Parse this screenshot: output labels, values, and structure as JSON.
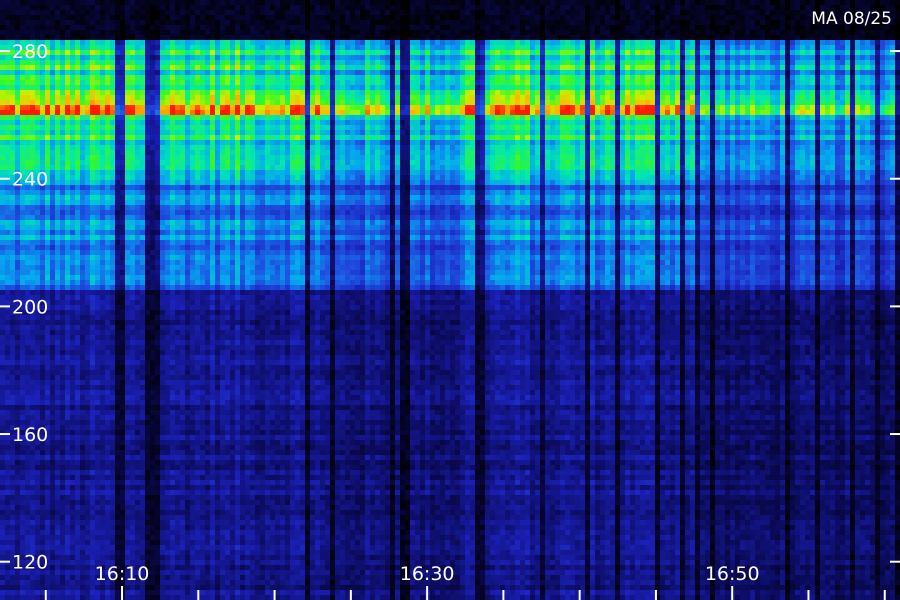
{
  "chart_data": {
    "type": "heatmap",
    "corner_label": "MA 08/25",
    "y_ticks": [
      280,
      240,
      200,
      160,
      120
    ],
    "ylim": [
      108,
      296
    ],
    "x_ticks": [
      "16:10",
      "16:30",
      "16:50"
    ],
    "xlim": [
      "16:02",
      "17:01"
    ],
    "grid": false,
    "colormap": [
      "#000000",
      "#0b0a58",
      "#1b20b8",
      "#1e4fe0",
      "#05a6f0",
      "#00e8b0",
      "#34f82a",
      "#c8f000",
      "#ffb000",
      "#ff1a00"
    ],
    "bands": [
      {
        "y": [
          260,
          268
        ],
        "intensity": 0.9
      },
      {
        "y": [
          240,
          284
        ],
        "intensity": 0.62
      },
      {
        "y": [
          205,
          240
        ],
        "intensity": 0.42
      },
      {
        "y": [
          108,
          205
        ],
        "intensity": 0.18
      }
    ],
    "bright_periods": [
      {
        "x": [
          "16:02",
          "16:23"
        ],
        "level": 1.0
      },
      {
        "x": [
          "16:23",
          "16:32"
        ],
        "level": 0.7
      },
      {
        "x": [
          "16:32",
          "16:48"
        ],
        "level": 1.0
      },
      {
        "x": [
          "16:48",
          "17:01"
        ],
        "level": 0.5
      }
    ]
  }
}
